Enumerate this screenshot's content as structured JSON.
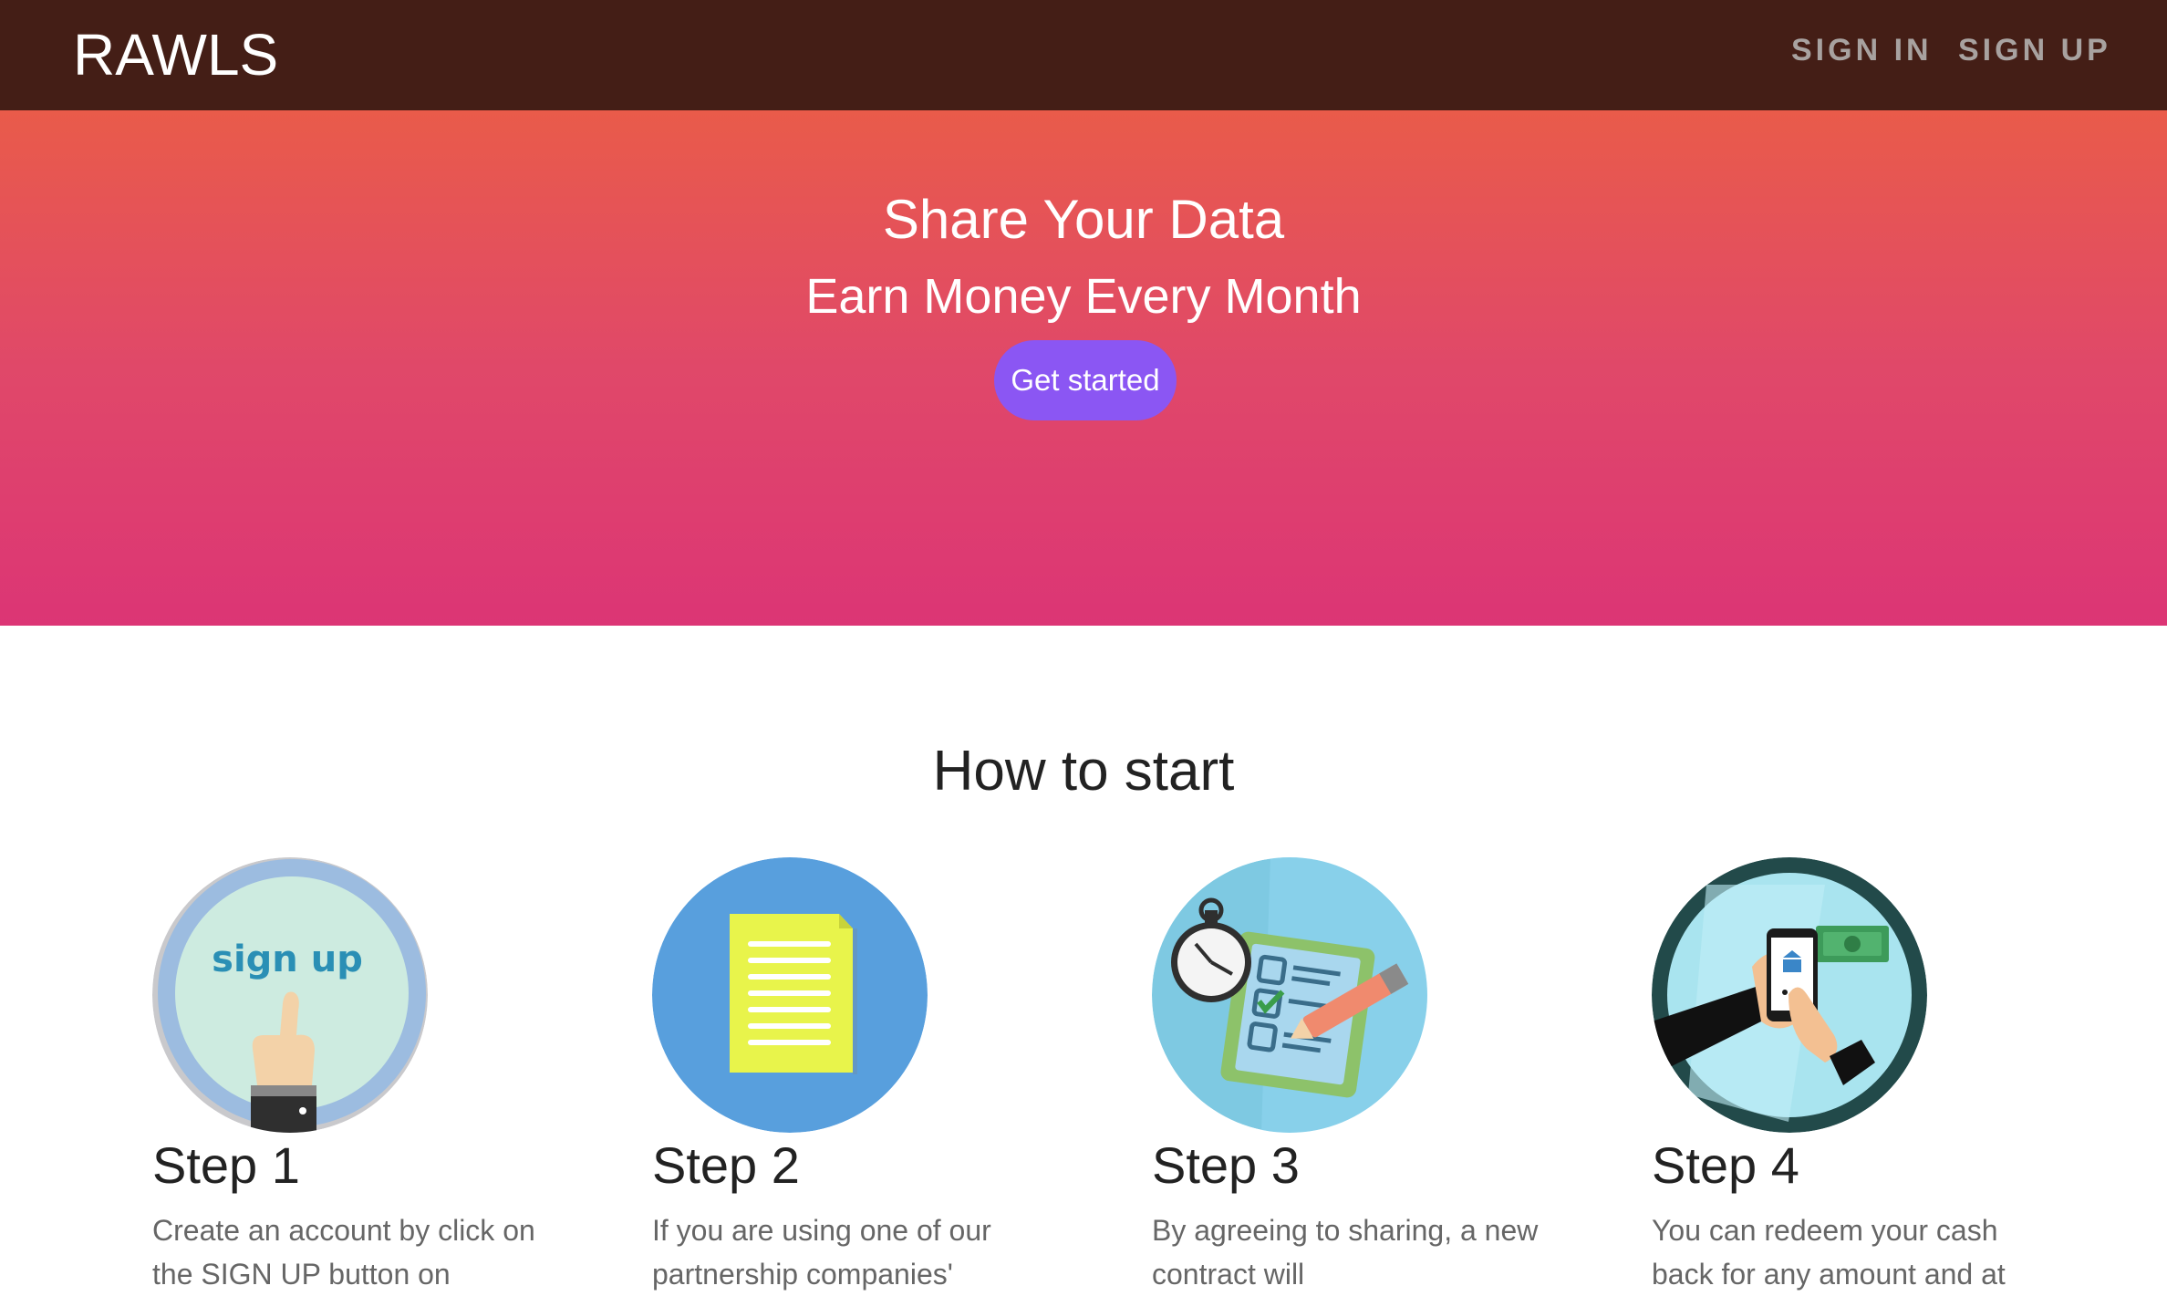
{
  "navbar": {
    "brand": "RAWLS",
    "links": [
      {
        "label": "SIGN IN"
      },
      {
        "label": "SIGN UP"
      }
    ]
  },
  "hero": {
    "title": "Share Your Data",
    "subtitle": "Earn Money Every Month",
    "cta_label": "Get started",
    "gradient_top": "#e95b4a",
    "gradient_bottom": "#dc3575",
    "cta_color": "#8b56f3"
  },
  "how_to_start": {
    "title": "How to start",
    "steps": [
      {
        "icon": "sign-up-hand-icon",
        "icon_text": "sign up",
        "title": "Step 1",
        "text": "Create an account by click on the SIGN UP button on"
      },
      {
        "icon": "document-icon",
        "title": "Step 2",
        "text": "If you are using one of our partnership companies'"
      },
      {
        "icon": "checklist-stopwatch-icon",
        "title": "Step 3",
        "text": "By agreeing to sharing, a new contract will"
      },
      {
        "icon": "mobile-payment-icon",
        "title": "Step 4",
        "text": "You can redeem your cash back for any amount and at"
      }
    ]
  },
  "colors": {
    "navbar_bg": "#441e16",
    "nav_link": "#a8a2a0",
    "heading": "#222222",
    "body_text": "#666666"
  }
}
